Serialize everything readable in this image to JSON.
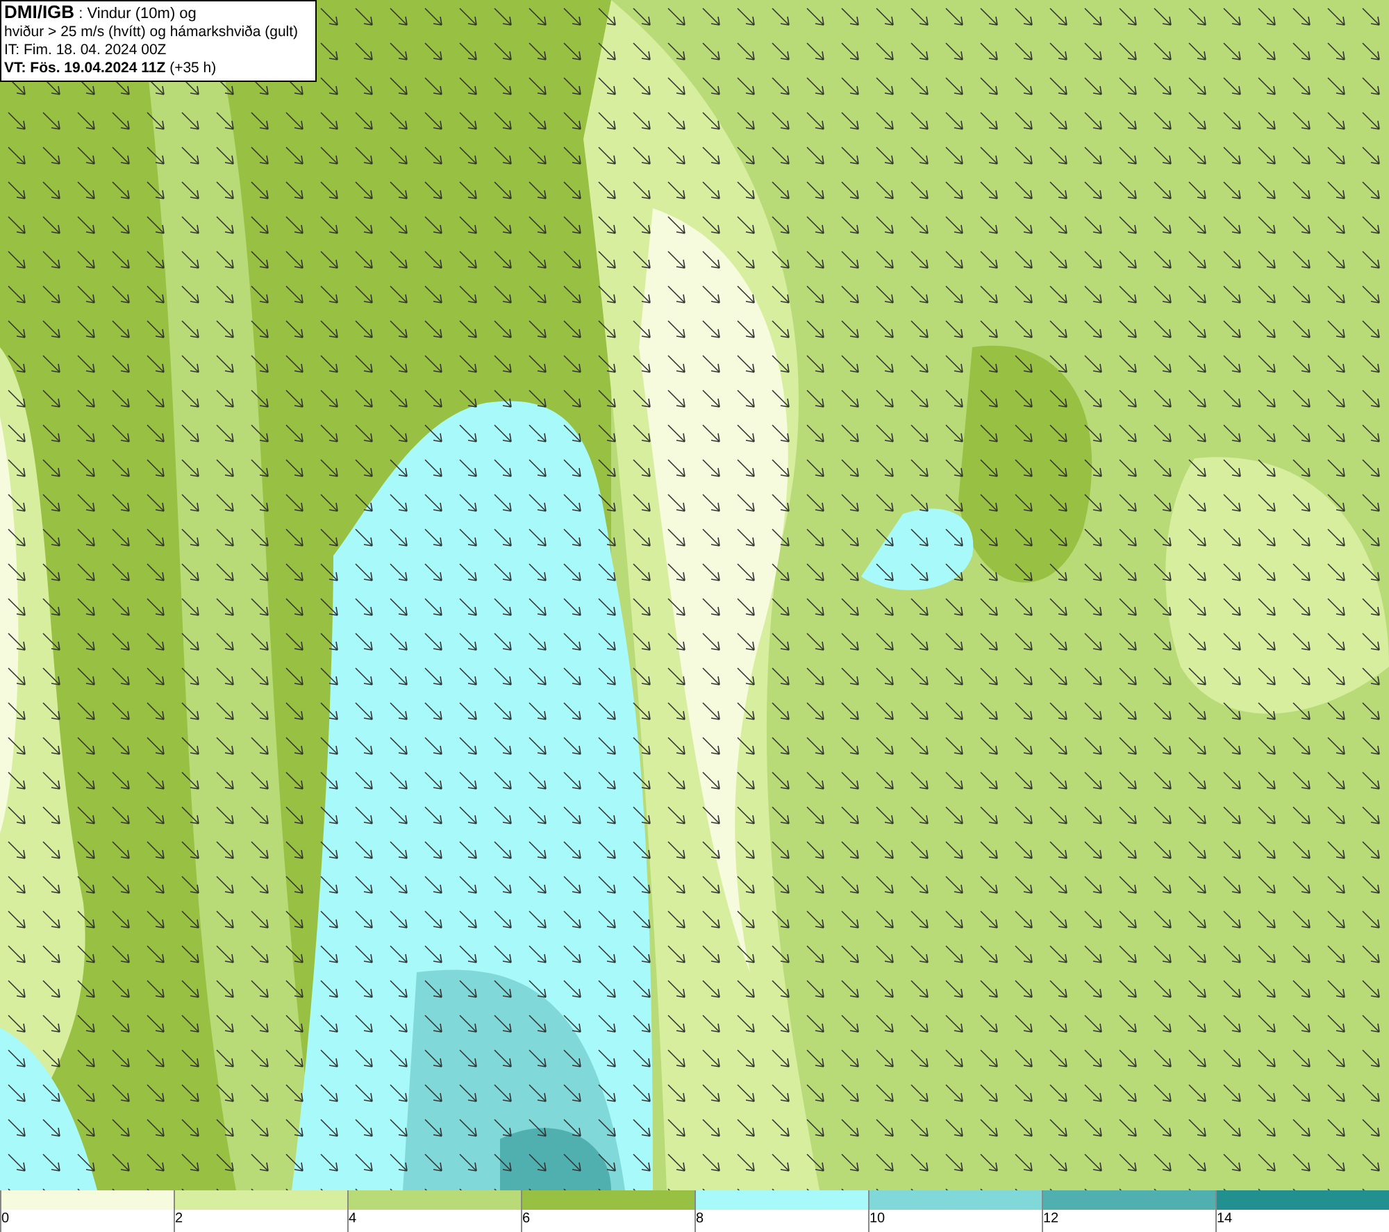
{
  "info_box": {
    "lines": [
      "**DMI/IGB** : Vindur (10m) og",
      "hviður > 25 m/s (hvítt) og hámarkshviða (gult)",
      "IT: Fim. 18. 04. 2024 00Z",
      "**VT: Fös. 19.04.2024 11Z** (+35 h)"
    ]
  },
  "legend": {
    "bins": [
      {
        "label": "0",
        "color": "#f5fbdc"
      },
      {
        "label": "2",
        "color": "#d8ee9f"
      },
      {
        "label": "4",
        "color": "#b8db78"
      },
      {
        "label": "6",
        "color": "#98c043"
      },
      {
        "label": "8",
        "color": "#a8fafa"
      },
      {
        "label": "10",
        "color": "#80d8d8"
      },
      {
        "label": "12",
        "color": "#50b0b0"
      },
      {
        "label": "14",
        "color": "#239090"
      }
    ]
  }
}
